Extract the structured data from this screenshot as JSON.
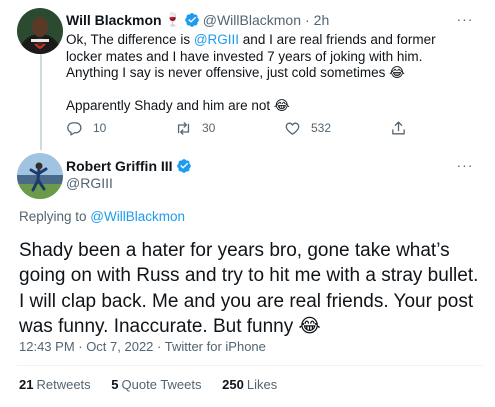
{
  "reply_tweet": {
    "name": "Will Blackmon",
    "name_emoji": "🍷",
    "handle": "@WillBlackmon",
    "separator": "·",
    "time": "2h",
    "more_glyph": "···",
    "line1_prefix": "Ok, The difference is ",
    "line1_mention": "@RGIII",
    "line1_suffix": " and I are real friends and former locker mates and I have invested 7 years of joking with him. Anything I say is never offensive, just cold sometimes 😂",
    "line2": "Apparently Shady and him are not 😂",
    "replies": "10",
    "retweets": "30",
    "likes": "532"
  },
  "main_tweet": {
    "name": "Robert Griffin III",
    "handle": "@RGIII",
    "more_glyph": "···",
    "replying_label": "Replying to ",
    "replying_mention": "@WillBlackmon",
    "text": "Shady been a hater for years bro, gone take what’s going on with Russ and try to hit me with a stray bullet. I will clap back. Me and you are real friends. Your post was funny. Inaccurate. But funny 😂",
    "timestamp": "12:43 PM · Oct 7, 2022 · Twitter for iPhone",
    "stats": {
      "retweets_count": "21",
      "retweets_label": "Retweets",
      "quotes_count": "5",
      "quotes_label": "Quote Tweets",
      "likes_count": "250",
      "likes_label": "Likes"
    }
  },
  "colors": {
    "accent": "#1d9bf0",
    "secondary_text": "#536471",
    "primary_text": "#0f1419",
    "divider": "#eff3f4"
  },
  "icons": {
    "verified": "verified-badge-icon",
    "reply": "reply-icon",
    "retweet": "retweet-icon",
    "like": "heart-icon",
    "share": "share-icon",
    "more": "more-icon"
  }
}
